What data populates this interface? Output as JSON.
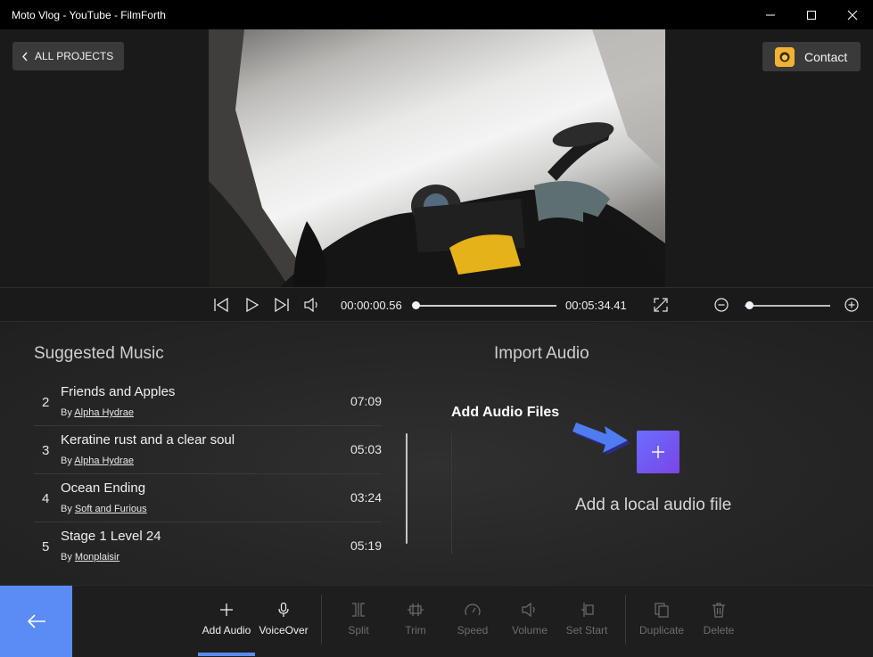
{
  "window": {
    "title": "Moto Vlog - YouTube - FilmForth"
  },
  "header": {
    "all_projects_label": "ALL PROJECTS",
    "contact_label": "Contact"
  },
  "player": {
    "current_time": "00:00:00.56",
    "total_time": "00:05:34.41",
    "seek_progress": 0.0,
    "zoom_level": 0.05
  },
  "suggested_music": {
    "title": "Suggested Music",
    "by_prefix": "By",
    "tracks": [
      {
        "num": "2",
        "name": "Friends and Apples",
        "artist": "Alpha Hydrae",
        "duration": "07:09"
      },
      {
        "num": "3",
        "name": "Keratine rust and a clear soul",
        "artist": "Alpha Hydrae",
        "duration": "05:03"
      },
      {
        "num": "4",
        "name": "Ocean Ending",
        "artist": "Soft and Furious",
        "duration": "03:24"
      },
      {
        "num": "5",
        "name": "Stage 1 Level 24",
        "artist": "Monplaisir",
        "duration": "05:19"
      }
    ]
  },
  "import_audio": {
    "title": "Import Audio",
    "callout": "Add Audio Files",
    "add_local_label": "Add a local audio file"
  },
  "toolbar": {
    "add_audio": "Add Audio",
    "voiceover": "VoiceOver",
    "split": "Split",
    "trim": "Trim",
    "speed": "Speed",
    "volume": "Volume",
    "set_start": "Set Start",
    "duplicate": "Duplicate",
    "delete": "Delete"
  },
  "colors": {
    "accent": "#5b8cf6",
    "add_button": "#6a6dff",
    "contact_icon": "#f2b233",
    "callout_arrow": "#4f7cf0"
  },
  "icons": [
    "minimize-icon",
    "maximize-icon",
    "close-icon",
    "chevron-left-icon",
    "contact-avatar-icon",
    "skip-start-icon",
    "play-icon",
    "skip-end-icon",
    "volume-icon",
    "fullscreen-icon",
    "zoom-out-icon",
    "zoom-in-icon",
    "plus-icon",
    "microphone-icon",
    "split-icon",
    "trim-icon",
    "speed-icon",
    "set-start-icon",
    "duplicate-icon",
    "trash-icon",
    "arrow-left-icon"
  ]
}
